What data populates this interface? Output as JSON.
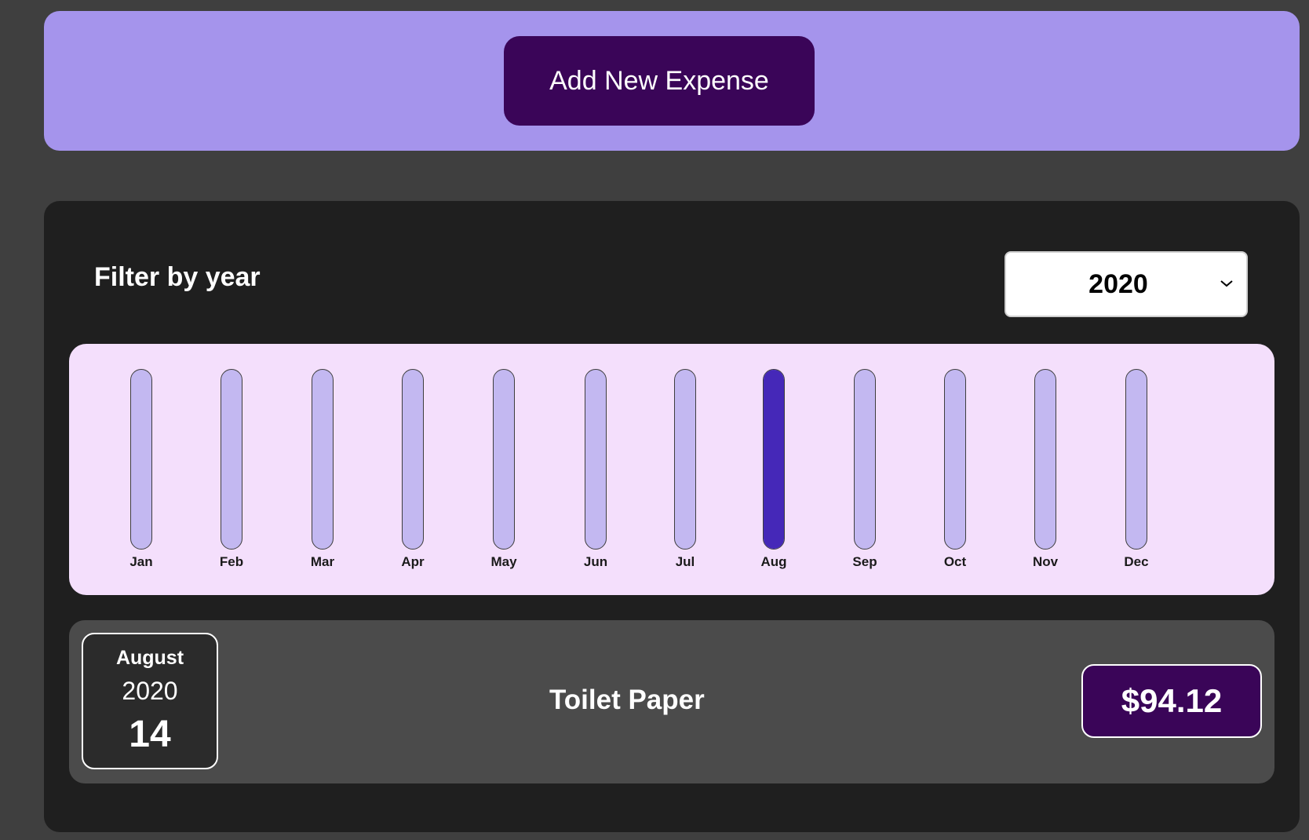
{
  "new_expense": {
    "button_label": "Add New Expense"
  },
  "filter": {
    "label": "Filter by year",
    "selected_year": "2020",
    "chevron_icon": "chevron-down-icon"
  },
  "chart_data": {
    "type": "bar",
    "categories": [
      "Jan",
      "Feb",
      "Mar",
      "Apr",
      "May",
      "Jun",
      "Jul",
      "Aug",
      "Sep",
      "Oct",
      "Nov",
      "Dec"
    ],
    "values": [
      0,
      0,
      0,
      0,
      0,
      0,
      0,
      94.12,
      0,
      0,
      0,
      0
    ],
    "max_value": 94.12,
    "colors": {
      "empty": "#c3b8f1",
      "fill": "#4528b8",
      "background": "#f4dffc"
    }
  },
  "expenses": [
    {
      "month": "August",
      "year": "2020",
      "day": "14",
      "title": "Toilet Paper",
      "amount": "$94.12"
    }
  ],
  "colors": {
    "accent": "#a594ec",
    "button": "#3a0558",
    "panel": "#1f1f1f",
    "item": "#4b4b4b"
  }
}
